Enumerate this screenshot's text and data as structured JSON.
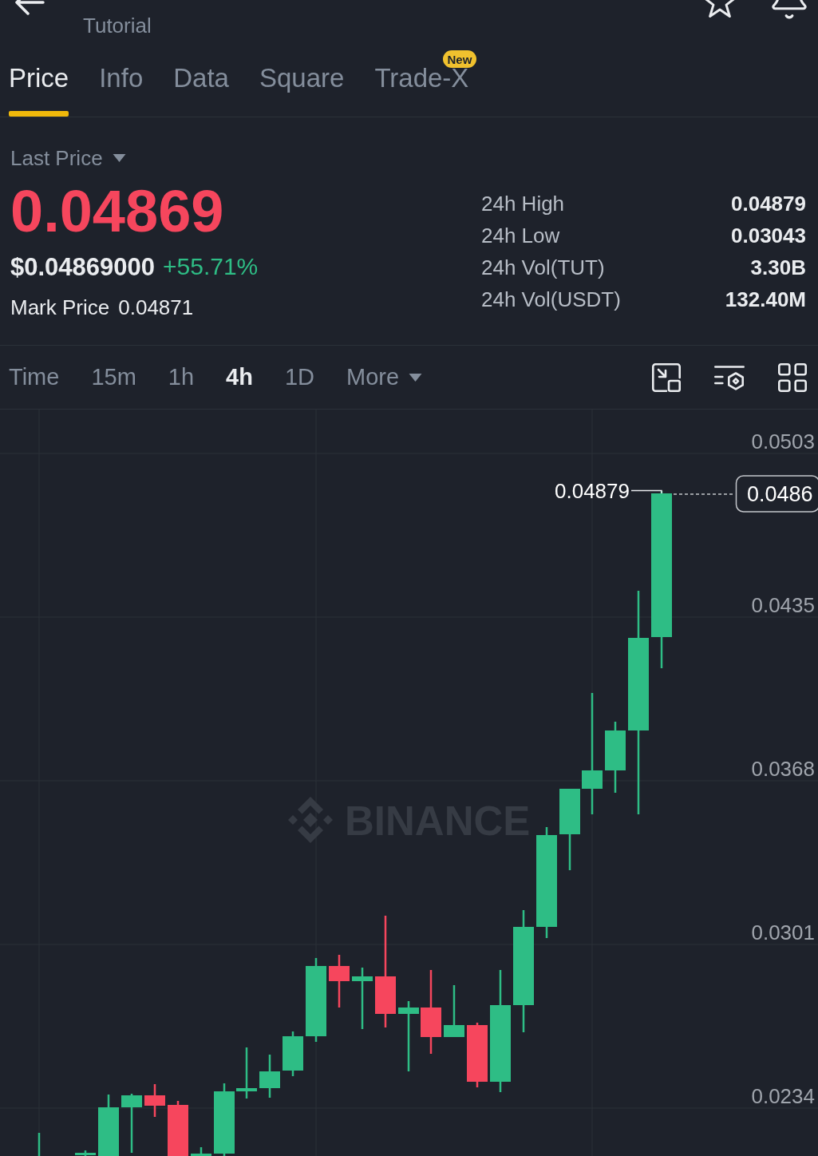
{
  "header": {
    "subtitle": "Tutorial"
  },
  "tabs": [
    {
      "label": "Price",
      "selected": true
    },
    {
      "label": "Info",
      "selected": false
    },
    {
      "label": "Data",
      "selected": false
    },
    {
      "label": "Square",
      "selected": false
    },
    {
      "label": "Trade-X",
      "selected": false,
      "badge": "New"
    }
  ],
  "ticker": {
    "price_mode": "Last Price",
    "last_price": "0.04869",
    "usd_price": "$0.04869000",
    "change": "+55.71%",
    "mark_price": {
      "label": "Mark Price",
      "value": "0.04871"
    },
    "stats": [
      {
        "label": "24h High",
        "value": "0.04879"
      },
      {
        "label": "24h Low",
        "value": "0.03043"
      },
      {
        "label": "24h Vol(TUT)",
        "value": "3.30B"
      },
      {
        "label": "24h Vol(USDT)",
        "value": "132.40M"
      }
    ]
  },
  "intervals": [
    {
      "kind": "option",
      "label": "Time",
      "selected": false
    },
    {
      "kind": "option",
      "label": "15m",
      "selected": false
    },
    {
      "kind": "option",
      "label": "1h",
      "selected": false
    },
    {
      "kind": "option",
      "label": "4h",
      "selected": true
    },
    {
      "kind": "option",
      "label": "1D",
      "selected": false
    },
    {
      "kind": "menu",
      "label": "More",
      "selected": false
    }
  ],
  "chart": {
    "watermark": "BINANCE",
    "price_scale": [
      "0.0503",
      "0.0435",
      "0.0368",
      "0.0301",
      "0.0234"
    ],
    "high_label": "0.04879",
    "current_price": "0.0486"
  }
}
